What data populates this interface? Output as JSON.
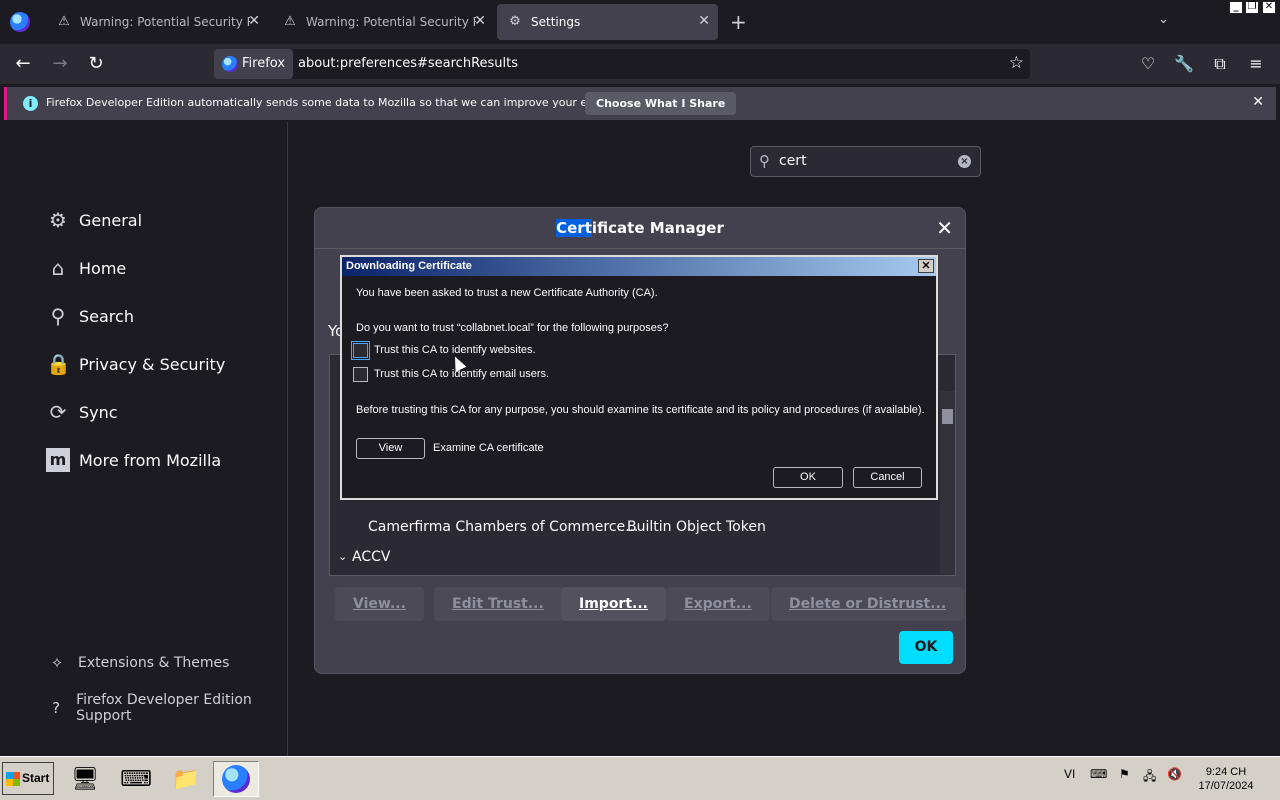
{
  "tabs": [
    {
      "label": "Warning: Potential Security Risk Ahead",
      "icon": "warning-icon"
    },
    {
      "label": "Warning: Potential Security Risk Ahead",
      "icon": "warning-icon"
    },
    {
      "label": "Settings",
      "icon": "gear-icon"
    }
  ],
  "nav": {
    "identity_label": "Firefox",
    "url": "about:preferences#searchResults"
  },
  "notification": {
    "message": "Firefox Developer Edition automatically sends some data to Mozilla so that we can improve your experience.",
    "button": "Choose What I Share"
  },
  "sidebar": {
    "categories": [
      {
        "label": "General",
        "icon": "gear-icon"
      },
      {
        "label": "Home",
        "icon": "home-icon"
      },
      {
        "label": "Search",
        "icon": "search-icon"
      },
      {
        "label": "Privacy & Security",
        "icon": "lock-icon"
      },
      {
        "label": "Sync",
        "icon": "sync-icon"
      },
      {
        "label": "More from Mozilla",
        "icon": "mozilla-icon"
      }
    ],
    "footer": [
      {
        "label": "Extensions & Themes",
        "icon": "puzzle-icon"
      },
      {
        "label": "Firefox Developer Edition Support",
        "icon": "help-icon"
      }
    ]
  },
  "search": {
    "value": "cert"
  },
  "cert_manager": {
    "title_highlight": "Cert",
    "title_rest": "ificate Manager",
    "partial_label": "Yo",
    "rows": [
      {
        "col1": "Camerfirma Chambers of Commerce...",
        "col2": "Builtin Object Token"
      },
      {
        "label": "ACCV"
      }
    ],
    "buttons": {
      "view": "View...",
      "edit_trust": "Edit Trust...",
      "import": "Import...",
      "export": "Export...",
      "delete": "Delete or Distrust..."
    },
    "ok": "OK"
  },
  "download_dialog": {
    "title": "Downloading Certificate",
    "line1": "You have been asked to trust a new Certificate Authority (CA).",
    "question": "Do you want to trust “collabnet.local” for the following purposes?",
    "cb_websites": "Trust this CA to identify websites.",
    "cb_email": "Trust this CA to identify email users.",
    "advice": "Before trusting this CA for any purpose, you should examine its certificate and its policy and procedures (if available).",
    "view_button": "View",
    "view_caption": "Examine CA certificate",
    "ok": "OK",
    "cancel": "Cancel"
  },
  "taskbar": {
    "start": "Start",
    "lang": "VI",
    "time": "9:24 CH",
    "date": "17/07/2024"
  }
}
